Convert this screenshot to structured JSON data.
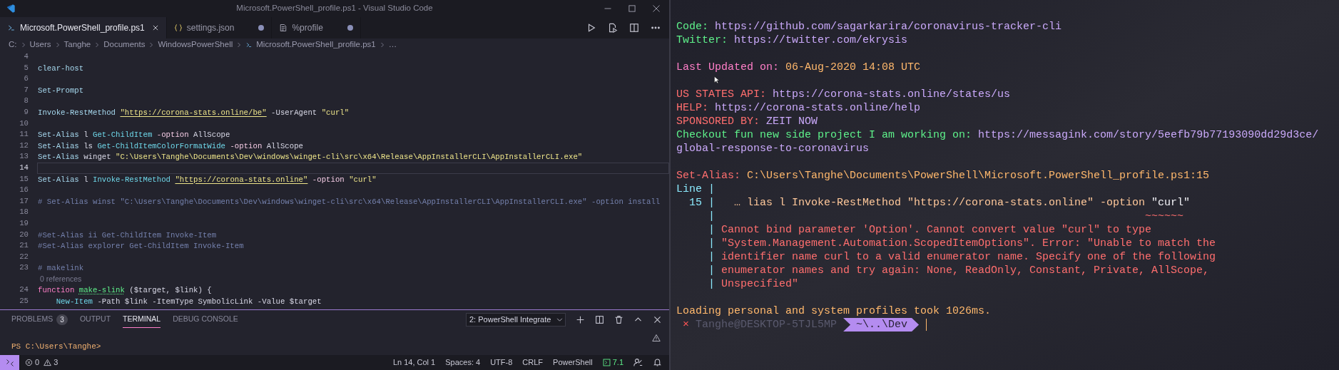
{
  "window": {
    "title": "Microsoft.PowerShell_profile.ps1 - Visual Studio Code"
  },
  "tabs": [
    {
      "label": "Microsoft.PowerShell_profile.ps1",
      "kind": "powershell",
      "selected": true,
      "modified": false
    },
    {
      "label": "settings.json",
      "kind": "json",
      "selected": false,
      "modified": true
    },
    {
      "label": "%profile",
      "kind": "file",
      "selected": false,
      "modified": true
    }
  ],
  "breadcrumb": [
    {
      "label": "C:",
      "kind": "folder"
    },
    {
      "label": "Users",
      "kind": "folder"
    },
    {
      "label": "Tanghe",
      "kind": "folder"
    },
    {
      "label": "Documents",
      "kind": "folder"
    },
    {
      "label": "WindowsPowerShell",
      "kind": "folder"
    },
    {
      "label": "Microsoft.PowerShell_profile.ps1",
      "kind": "file"
    },
    {
      "label": "…",
      "kind": "symbol"
    }
  ],
  "editor": {
    "lines": [
      {
        "number": "4",
        "current": false
      },
      {
        "number": "5",
        "current": false,
        "tokens": [
          {
            "text": "clear-host",
            "kind": "cmd"
          }
        ]
      },
      {
        "number": "6",
        "current": false
      },
      {
        "number": "7",
        "current": false,
        "tokens": [
          {
            "text": "Set-Prompt",
            "kind": "cmd"
          }
        ]
      },
      {
        "number": "8",
        "current": false
      },
      {
        "number": "9",
        "current": false,
        "tokens": [
          {
            "text": "Invoke-RestMethod ",
            "kind": "cmd"
          },
          {
            "text": "\"https://corona-stats.online/be\"",
            "kind": "link"
          },
          {
            "text": " -UserAgent ",
            "kind": "plain"
          },
          {
            "text": "\"curl\"",
            "kind": "string"
          }
        ]
      },
      {
        "number": "10",
        "current": false
      },
      {
        "number": "11",
        "current": false,
        "tokens": [
          {
            "text": "Set-Alias",
            "kind": "cmd"
          },
          {
            "text": " l ",
            "kind": "plain"
          },
          {
            "text": "Get-ChildItem",
            "kind": "cmdlet"
          },
          {
            "text": " -option",
            "kind": "param"
          },
          {
            "text": " AllScope",
            "kind": "plain"
          }
        ]
      },
      {
        "number": "12",
        "current": false,
        "tokens": [
          {
            "text": "Set-Alias",
            "kind": "cmd"
          },
          {
            "text": " ls ",
            "kind": "plain"
          },
          {
            "text": "Get-ChildItemColorFormatWide",
            "kind": "cmdlet"
          },
          {
            "text": " -option",
            "kind": "param"
          },
          {
            "text": " AllScope",
            "kind": "plain"
          }
        ]
      },
      {
        "number": "13",
        "current": false,
        "tokens": [
          {
            "text": "Set-Alias",
            "kind": "cmd"
          },
          {
            "text": " winget ",
            "kind": "plain"
          },
          {
            "text": "\"C:\\Users\\Tanghe\\Documents\\Dev\\windows\\winget-cli\\src\\x64\\Release\\AppInstallerCLI\\AppInstallerCLI.exe\"",
            "kind": "string"
          }
        ]
      },
      {
        "number": "14",
        "current": true
      },
      {
        "number": "15",
        "current": false,
        "tokens": [
          {
            "text": "Set-Alias",
            "kind": "cmd"
          },
          {
            "text": " l ",
            "kind": "plain"
          },
          {
            "text": "Invoke-RestMethod ",
            "kind": "cmdlet"
          },
          {
            "text": "\"https://corona-stats.online\"",
            "kind": "link"
          },
          {
            "text": " -option ",
            "kind": "param"
          },
          {
            "text": "\"curl\"",
            "kind": "string"
          }
        ]
      },
      {
        "number": "16",
        "current": false
      },
      {
        "number": "17",
        "current": false,
        "tokens": [
          {
            "text": "# Set-Alias winst \"C:\\Users\\Tanghe\\Documents\\Dev\\windows\\winget-cli\\src\\x64\\Release\\AppInstallerCLI\\AppInstallerCLI.exe\" -option install",
            "kind": "comment"
          }
        ]
      },
      {
        "number": "18",
        "current": false
      },
      {
        "number": "19",
        "current": false
      },
      {
        "number": "20",
        "current": false,
        "tokens": [
          {
            "text": "#Set-Alias ii Get-ChildItem Invoke-Item",
            "kind": "comment"
          }
        ]
      },
      {
        "number": "21",
        "current": false,
        "tokens": [
          {
            "text": "#Set-Alias explorer Get-ChildItem Invoke-Item",
            "kind": "comment"
          }
        ]
      },
      {
        "number": "22",
        "current": false
      },
      {
        "number": "23",
        "current": false,
        "tokens": [
          {
            "text": "# makelink",
            "kind": "comment"
          }
        ]
      },
      {
        "kind": "codelens",
        "text": "0 references"
      },
      {
        "number": "24",
        "current": false,
        "tokens": [
          {
            "text": "function ",
            "kind": "keyword"
          },
          {
            "text": "make-slink",
            "kind": "func"
          },
          {
            "text": " ($target, $link) {",
            "kind": "plain"
          }
        ]
      },
      {
        "number": "25",
        "current": false,
        "tokens": [
          {
            "text": "    New-Item",
            "kind": "cmdlet"
          },
          {
            "text": " -Path $link -ItemType SymbolicLink -Value $target",
            "kind": "plain"
          }
        ]
      }
    ]
  },
  "panel": {
    "tabs": [
      {
        "label": "PROBLEMS",
        "badge": "3",
        "selected": false
      },
      {
        "label": "OUTPUT",
        "selected": false
      },
      {
        "label": "TERMINAL",
        "selected": true
      },
      {
        "label": "DEBUG CONSOLE",
        "selected": false
      }
    ],
    "terminal_picker": "2: PowerShell Integrate",
    "terminal_lines": [
      "PS C:\\Users\\Tanghe>"
    ]
  },
  "status_bar": {
    "errors": "0",
    "warnings": "3",
    "items": [
      "Ln 14, Col 1",
      "Spaces: 4",
      "UTF-8",
      "CRLF",
      "PowerShell"
    ],
    "version": "7.1"
  },
  "terminal": {
    "blocks": [
      [
        [
          {
            "text": "Code:",
            "kind": "green"
          },
          {
            "text": " https://github.com/sagarkarira/coronavirus-tracker-cli",
            "kind": "purple"
          }
        ],
        [
          {
            "text": "Twitter:",
            "kind": "green"
          },
          {
            "text": " https://twitter.com/ekrysis",
            "kind": "purple"
          }
        ]
      ],
      [
        [
          {
            "text": "Last Updated on:",
            "kind": "pink"
          },
          {
            "text": " 06-Aug-2020 14:08 UTC",
            "kind": "orange"
          }
        ]
      ],
      [
        [
          {
            "text": "US STATES API:",
            "kind": "red"
          },
          {
            "text": " https://corona-stats.online/states/us",
            "kind": "purple"
          }
        ],
        [
          {
            "text": "HELP:",
            "kind": "red"
          },
          {
            "text": " https://corona-stats.online/help",
            "kind": "purple"
          }
        ],
        [
          {
            "text": "SPONSORED BY:",
            "kind": "red"
          },
          {
            "text": " ZEIT NOW",
            "kind": "purple"
          }
        ],
        [
          {
            "text": "Checkout fun new side project I am working on:",
            "kind": "green"
          },
          {
            "text": " https://messagink.com/story/5eefb79b77193090dd29d3ce/",
            "kind": "purple"
          }
        ],
        [
          {
            "text": "global-response-to-coronavirus",
            "kind": "purple"
          }
        ]
      ],
      [
        [
          {
            "text": "Set-Alias:",
            "kind": "red"
          },
          {
            "text": " C:\\Users\\Tanghe\\Documents\\PowerShell\\Microsoft.PowerShell_profile.ps1:15",
            "kind": "orange"
          }
        ],
        [
          {
            "text": "Line |",
            "kind": "gutter"
          }
        ],
        [
          {
            "text": "15 |",
            "kind": "gutter"
          },
          {
            "text": "  … lias l Invoke-RestMethod \"https://corona-stats.online\" -option ",
            "kind": "peach"
          },
          {
            "text": "\"curl\"",
            "kind": "white"
          }
        ],
        [
          {
            "text": "|",
            "kind": "gutter"
          },
          {
            "text": "~~~~~~",
            "kind": "squiggle"
          }
        ],
        [
          {
            "text": "|",
            "kind": "gutter"
          },
          {
            "text": "Cannot bind parameter 'Option'. Cannot convert value \"curl\" to type",
            "kind": "error"
          }
        ],
        [
          {
            "text": "|",
            "kind": "gutter"
          },
          {
            "text": "\"System.Management.Automation.ScopedItemOptions\". Error: \"Unable to match the",
            "kind": "error"
          }
        ],
        [
          {
            "text": "|",
            "kind": "gutter"
          },
          {
            "text": "identifier name curl to a valid enumerator name. Specify one of the following",
            "kind": "error"
          }
        ],
        [
          {
            "text": "|",
            "kind": "gutter"
          },
          {
            "text": "enumerator names and try again: None, ReadOnly, Constant, Private, AllScope,",
            "kind": "error"
          }
        ],
        [
          {
            "text": "|",
            "kind": "gutter"
          },
          {
            "text": "Unspecified\"",
            "kind": "error"
          }
        ]
      ],
      [
        [
          {
            "text": "Loading personal and system profiles took 1026ms.",
            "kind": "orange"
          }
        ],
        [
          {
            "text": "×",
            "kind": "status"
          },
          {
            "text": "Tanghe@DESKTOP-5TJL5MP",
            "kind": "host"
          },
          {
            "text": "~\\..\\Dev",
            "kind": "segment"
          }
        ]
      ]
    ]
  }
}
